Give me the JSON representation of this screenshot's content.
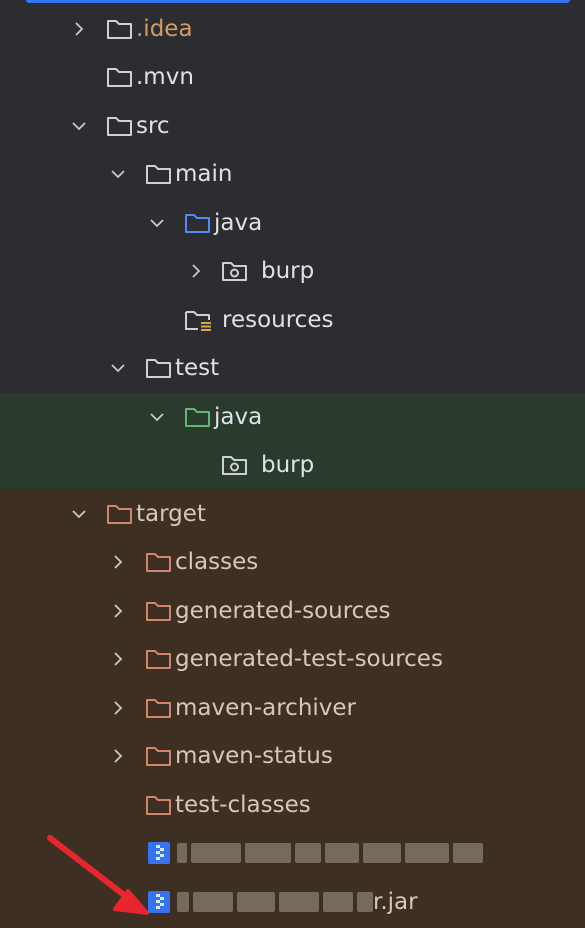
{
  "colors": {
    "background": "#2b2d30",
    "test_band": "#2a3a2c",
    "target_band": "#3d3023",
    "accent": "#3574f0",
    "excluded_folder": "#d3846a",
    "test_folder": "#5fb870",
    "arrow": "#e8262d"
  },
  "tree": {
    "idea": {
      "label": ".idea",
      "icon": "folder-icon"
    },
    "mvn": {
      "label": ".mvn",
      "icon": "folder-icon"
    },
    "src": {
      "label": "src",
      "icon": "folder-icon"
    },
    "main": {
      "label": "main",
      "icon": "folder-icon"
    },
    "main_java": {
      "label": "java",
      "icon": "source-root-folder-icon"
    },
    "main_burp": {
      "label": "burp",
      "icon": "package-icon"
    },
    "resources": {
      "label": "resources",
      "icon": "resources-folder-icon"
    },
    "test": {
      "label": "test",
      "icon": "folder-icon"
    },
    "test_java": {
      "label": "java",
      "icon": "test-root-folder-icon"
    },
    "test_burp": {
      "label": "burp",
      "icon": "package-icon"
    },
    "target": {
      "label": "target",
      "icon": "excluded-folder-icon"
    },
    "classes": {
      "label": "classes",
      "icon": "excluded-folder-icon"
    },
    "generated_sources": {
      "label": "generated-sources",
      "icon": "excluded-folder-icon"
    },
    "generated_test_sources": {
      "label": "generated-test-sources",
      "icon": "excluded-folder-icon"
    },
    "maven_archiver": {
      "label": "maven-archiver",
      "icon": "excluded-folder-icon"
    },
    "maven_status": {
      "label": "maven-status",
      "icon": "excluded-folder-icon"
    },
    "test_classes": {
      "label": "test-classes",
      "icon": "excluded-folder-icon"
    },
    "jar1": {
      "label": "",
      "icon": "jar-file-icon"
    },
    "jar2": {
      "label": "r.jar",
      "icon": "jar-file-icon"
    }
  }
}
